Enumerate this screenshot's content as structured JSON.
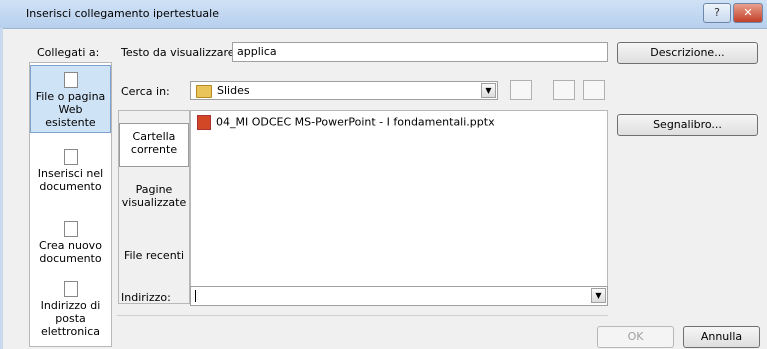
{
  "window": {
    "title": "Inserisci collegamento ipertestuale",
    "help_label": "?",
    "close_label": "✕"
  },
  "link_to": {
    "label": "Collegati a:",
    "items": [
      {
        "label": [
          "File o pagina",
          "Web",
          "esistente"
        ],
        "icon": "file-web-icon"
      },
      {
        "label": [
          "Inserisci nel",
          "documento"
        ],
        "icon": "document-place-icon"
      },
      {
        "label": [
          "Crea nuovo",
          "documento"
        ],
        "icon": "new-document-icon"
      },
      {
        "label": [
          "Indirizzo di",
          "posta",
          "elettronica"
        ],
        "icon": "email-icon"
      }
    ]
  },
  "text_to_display": {
    "label": "Testo da visualizzare:",
    "value": "applica"
  },
  "look_in": {
    "label": "Cerca in:",
    "value": "Slides"
  },
  "inner_nav": [
    {
      "label": [
        "Cartella",
        "corrente"
      ]
    },
    {
      "label": [
        "Pagine",
        "visualizzate"
      ]
    },
    {
      "label": [
        "File recenti"
      ]
    }
  ],
  "files": [
    {
      "name": "04_MI ODCEC MS-PowerPoint - I fondamentali.pptx",
      "icon": "pptx-icon"
    }
  ],
  "address": {
    "label": "Indirizzo:",
    "value": ""
  },
  "buttons": {
    "description": "Descrizione...",
    "bookmark": "Segnalibro...",
    "ok": "OK",
    "cancel": "Annulla"
  }
}
